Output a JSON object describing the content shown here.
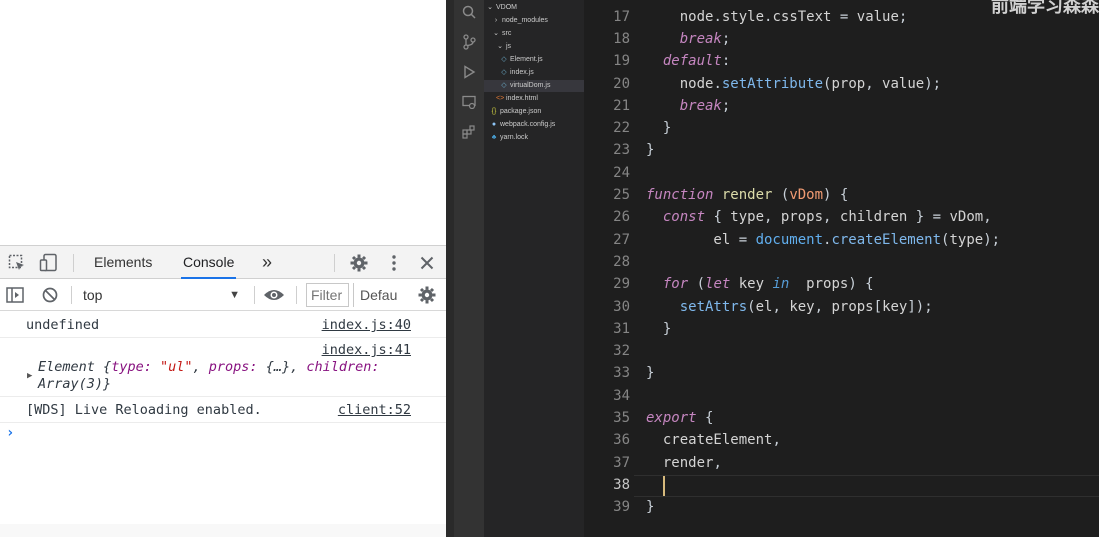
{
  "devtools": {
    "tabs": [
      {
        "label": "Elements",
        "active": false
      },
      {
        "label": "Console",
        "active": true
      }
    ],
    "more_tabs_label": "»",
    "context": "top",
    "filter_placeholder": "Filter",
    "levels_label": "Defau"
  },
  "console": {
    "lines": [
      {
        "message": "undefined",
        "source": "index.js:40"
      },
      {
        "source": "index.js:41",
        "object": {
          "name": "Element",
          "type_key": "type:",
          "type_val": "\"ul\"",
          "props_key": "props:",
          "props_val": "{…},",
          "children_key": "children:",
          "children_val": "Array(3)}"
        }
      },
      {
        "message": "[WDS] Live Reloading enabled.",
        "source": "client:52"
      }
    ],
    "prompt": "›"
  },
  "explorer": {
    "items": [
      {
        "label": "VDOM",
        "icon": "chevron-down",
        "indent": 0
      },
      {
        "label": "node_modules",
        "icon": "chevron-right",
        "indent": 1
      },
      {
        "label": "src",
        "icon": "chevron-down",
        "indent": 1
      },
      {
        "label": "js",
        "icon": "chevron-down",
        "indent": 2
      },
      {
        "label": "Element.js",
        "icon": "js",
        "indent": 3
      },
      {
        "label": "index.js",
        "icon": "js",
        "indent": 3
      },
      {
        "label": "virtualDom.js",
        "icon": "js",
        "indent": 3,
        "selected": true
      },
      {
        "label": "index.html",
        "icon": "html",
        "indent": 2
      },
      {
        "label": "package.json",
        "icon": "json",
        "indent": 1
      },
      {
        "label": "webpack.config.js",
        "icon": "gear",
        "indent": 1
      },
      {
        "label": "yarn.lock",
        "icon": "yarn",
        "indent": 1
      }
    ]
  },
  "editor": {
    "watermark": "前端学习森森",
    "line_numbers": [
      "17",
      "18",
      "19",
      "20",
      "21",
      "22",
      "23",
      "24",
      "25",
      "26",
      "27",
      "28",
      "29",
      "30",
      "31",
      "32",
      "33",
      "34",
      "35",
      "36",
      "37",
      "38",
      "39"
    ],
    "current_line": "38"
  }
}
